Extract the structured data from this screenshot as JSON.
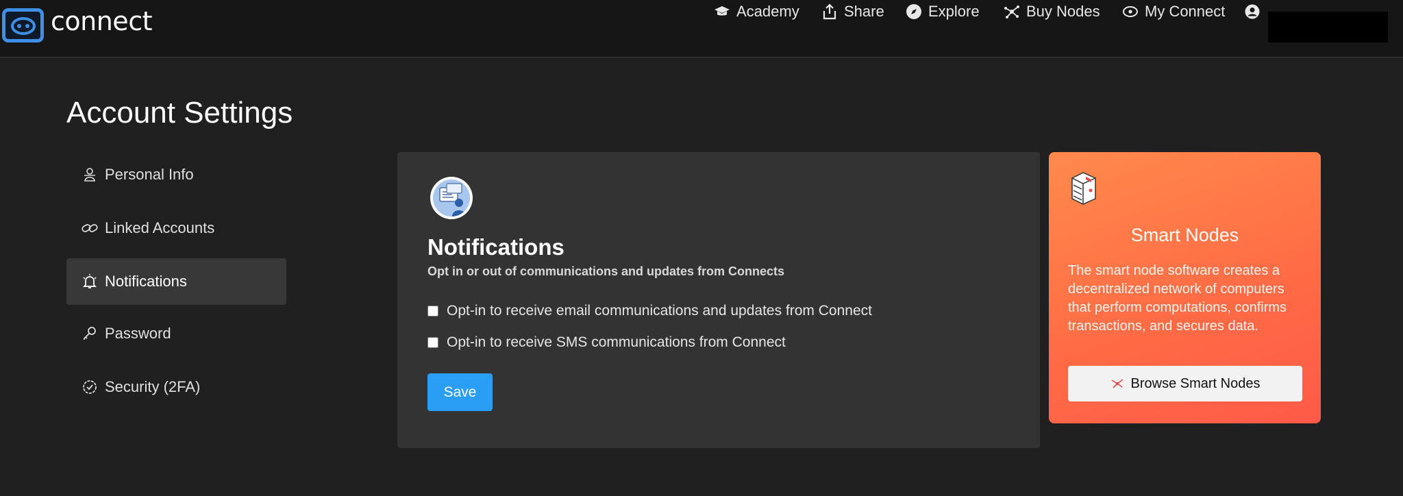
{
  "app": {
    "name": "connect"
  },
  "nav": {
    "items": [
      {
        "label": "Academy",
        "icon": "graduation-cap-icon"
      },
      {
        "label": "Share",
        "icon": "share-icon"
      },
      {
        "label": "Explore",
        "icon": "compass-icon"
      },
      {
        "label": "Buy Nodes",
        "icon": "nodes-icon"
      },
      {
        "label": "My Connect",
        "icon": "eye-icon"
      }
    ],
    "account_icon": "user-circle-icon"
  },
  "page": {
    "title": "Account Settings"
  },
  "sidebar": {
    "items": [
      {
        "label": "Personal Info",
        "icon": "person-icon",
        "active": false
      },
      {
        "label": "Linked Accounts",
        "icon": "link-icon",
        "active": false
      },
      {
        "label": "Notifications",
        "icon": "bell-icon",
        "active": true
      },
      {
        "label": "Password",
        "icon": "key-icon",
        "active": false
      },
      {
        "label": "Security (2FA)",
        "icon": "shield-check-icon",
        "active": false
      }
    ]
  },
  "notifications": {
    "title": "Notifications",
    "subtitle": "Opt in or out of communications and updates from Connects",
    "options": [
      {
        "label": "Opt-in to receive email communications and updates from Connect",
        "checked": false
      },
      {
        "label": "Opt-in to receive SMS communications from Connect",
        "checked": false
      }
    ],
    "save_label": "Save"
  },
  "promo": {
    "title": "Smart Nodes",
    "text": "The smart node software creates a decentralized network of computers that perform computations, confirms transactions, and secures data.",
    "button_label": "Browse Smart Nodes"
  },
  "colors": {
    "accent": "#2a9df4",
    "logo": "#3d8fe8",
    "promo_gradient_start": "#ff8a4c",
    "promo_gradient_end": "#ff5a48"
  }
}
